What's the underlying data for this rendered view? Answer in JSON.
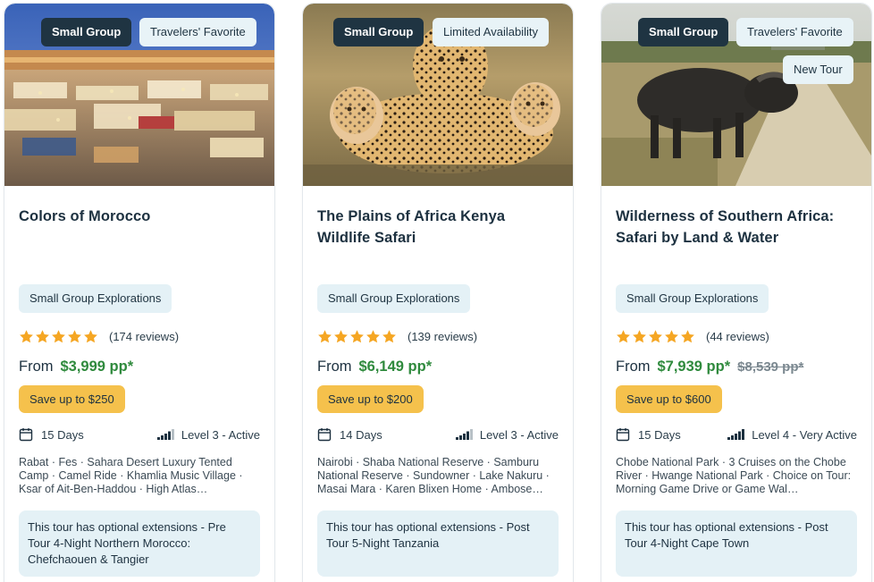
{
  "cards": [
    {
      "tags": [
        "Small Group",
        "Travelers' Favorite"
      ],
      "title": "Colors of Morocco",
      "collection": "Small Group Explorations",
      "rating": 5,
      "reviews": "(174 reviews)",
      "price_prefix": "From",
      "price": "$3,999 pp*",
      "save": "Save up to $250",
      "days": "15 Days",
      "level": "Level 3 - Active",
      "itinerary": "Rabat · Fes · Sahara Desert Luxury Tented Camp · Camel Ride · Khamlia Music Village · Ksar of Ait-Ben-Haddou · High Atlas…",
      "extension": "This tour has optional extensions - Pre Tour 4-Night Northern Morocco: Chefchaouen & Tangier"
    },
    {
      "tags": [
        "Small Group",
        "Limited Availability"
      ],
      "title": "The Plains of Africa Kenya Wildlife Safari",
      "collection": "Small Group Explorations",
      "rating": 5,
      "reviews": "(139 reviews)",
      "price_prefix": "From",
      "price": "$6,149 pp*",
      "save": "Save up to $200",
      "days": "14 Days",
      "level": "Level 3 - Active",
      "itinerary": "Nairobi · Shaba National Reserve · Samburu National Reserve · Sundowner · Lake Nakuru · Masai Mara · Karen Blixen Home · Ambose…",
      "extension": "This tour has optional extensions - Post Tour 5-Night Tanzania"
    },
    {
      "tags": [
        "Small Group",
        "Travelers' Favorite",
        "New Tour"
      ],
      "title": "Wilderness of Southern Africa: Safari by Land & Water",
      "collection": "Small Group Explorations",
      "rating": 5,
      "reviews": "(44 reviews)",
      "price_prefix": "From",
      "price": "$7,939 pp*",
      "old_price": "$8,539 pp*",
      "save": "Save up to $600",
      "days": "15 Days",
      "level": "Level 4 - Very Active",
      "itinerary": "Chobe National Park · 3 Cruises on the Chobe River · Hwange National Park · Choice on Tour: Morning Game Drive or Game Wal…",
      "extension": "This tour has optional extensions - Post Tour 4-Night Cape Town"
    }
  ],
  "icons": {
    "star": "star-icon",
    "calendar": "calendar-icon",
    "level": "activity-level-icon"
  },
  "colors": {
    "price_green": "#2f8a3d",
    "save_yellow": "#f5c14c",
    "tag_dark": "#1f3442",
    "pill_light": "#e4f1f6",
    "star": "#f5a623"
  }
}
